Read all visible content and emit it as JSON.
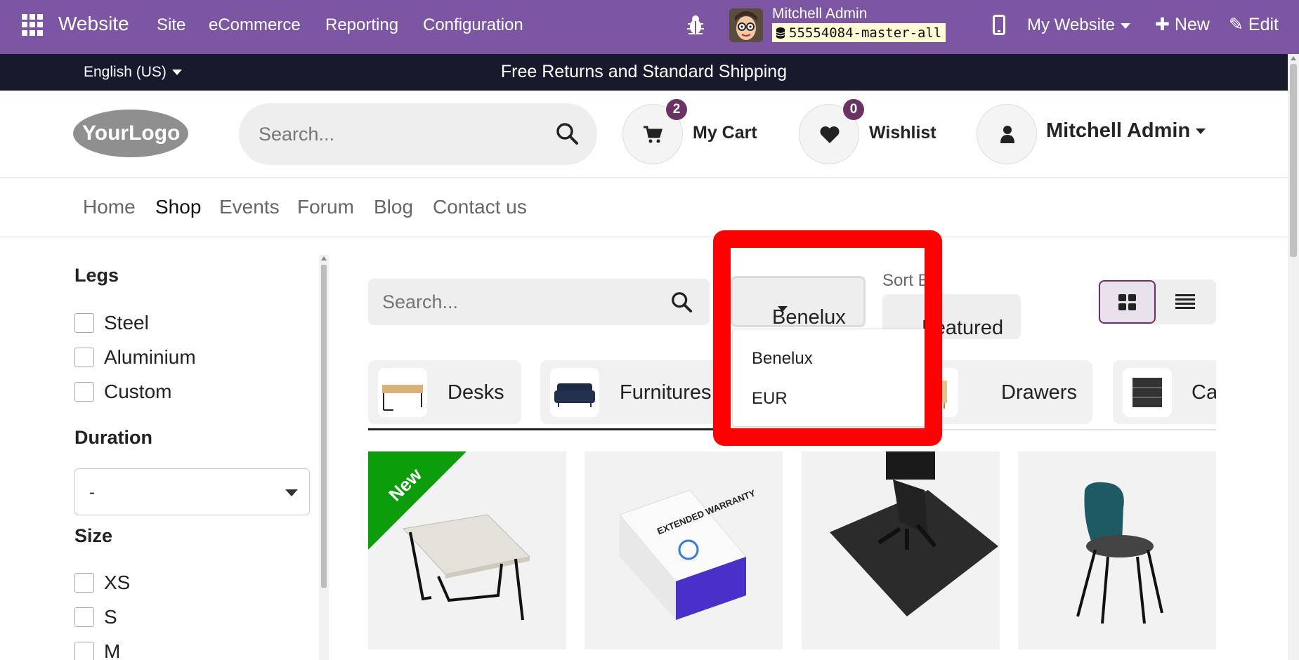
{
  "adminbar": {
    "brand": "Website",
    "menus": [
      "Site",
      "eCommerce",
      "Reporting",
      "Configuration"
    ],
    "user_name": "Mitchell Admin",
    "db_name": "55554084-master-all",
    "site_switch": "My Website",
    "new_label": "New",
    "edit_label": "Edit",
    "color": "#7c55a3"
  },
  "announce": {
    "language": "English (US)",
    "text": "Free Returns and Standard Shipping"
  },
  "header": {
    "logo_text": "YourLogo",
    "search_placeholder": "Search...",
    "cart_label": "My Cart",
    "cart_count": "2",
    "wishlist_label": "Wishlist",
    "wishlist_count": "0",
    "user_label": "Mitchell Admin"
  },
  "nav": {
    "items": [
      "Home",
      "Shop",
      "Events",
      "Forum",
      "Blog",
      "Contact us"
    ],
    "active": "Shop"
  },
  "sidebar": {
    "legs_title": "Legs",
    "legs_options": [
      "Steel",
      "Aluminium",
      "Custom"
    ],
    "duration_title": "Duration",
    "duration_value": "-",
    "size_title": "Size",
    "size_options": [
      "XS",
      "S",
      "M"
    ]
  },
  "toolbar": {
    "search_placeholder": "Search...",
    "pricelist_selected": "Benelux",
    "pricelist_options": [
      "Benelux",
      "EUR"
    ],
    "sortby_label": "Sort By",
    "sortby_value": "Featured"
  },
  "categories": [
    "Desks",
    "Furnitures",
    "Drawers",
    "Ca"
  ],
  "products": [
    {
      "ribbon": "New",
      "icon": "desk-table-image"
    },
    {
      "label": "EXTENDED WARRANTY",
      "icon": "warranty-box-image"
    },
    {
      "icon": "office-chair-mat-image"
    },
    {
      "icon": "dining-chair-image"
    }
  ],
  "colors": {
    "accent": "#6b3363",
    "highlight": "#ff0000",
    "ribbon": "#0b9d0a",
    "announce_bg": "#171a2c"
  }
}
